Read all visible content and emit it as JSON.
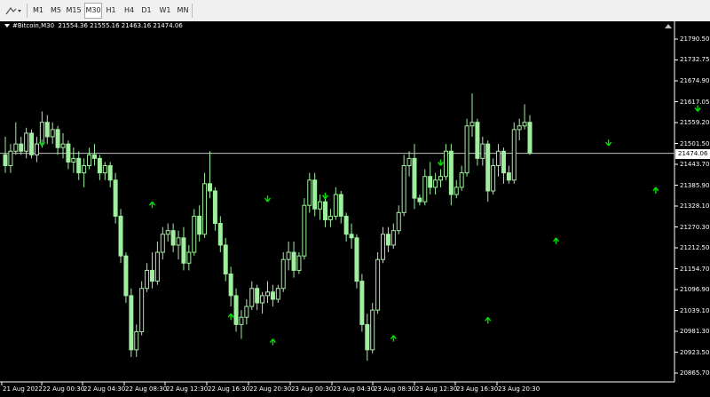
{
  "toolbar": {
    "timeframes": [
      "M1",
      "M5",
      "M15",
      "M30",
      "H1",
      "H4",
      "D1",
      "W1",
      "MN"
    ],
    "active": "M30"
  },
  "chart": {
    "symbol": "#Bitcoin,M30",
    "ohlc": "21554.36 21555.16 21463.16 21474.06",
    "current_price": "21474.06",
    "price_labels": [
      "21790.50",
      "21732.75",
      "21674.90",
      "21617.05",
      "21559.20",
      "21501.50",
      "21443.70",
      "21385.90",
      "21328.10",
      "21270.30",
      "21212.50",
      "21154.70",
      "21096.90",
      "21039.10",
      "20981.30",
      "20923.50",
      "20865.70"
    ],
    "time_labels": [
      "21 Aug 2022",
      "22 Aug 00:30",
      "22 Aug 04:30",
      "22 Aug 08:30",
      "22 Aug 12:30",
      "22 Aug 16:30",
      "22 Aug 20:30",
      "23 Aug 00:30",
      "23 Aug 04:30",
      "23 Aug 08:30",
      "23 Aug 12:30",
      "23 Aug 16:30",
      "23 Aug 20:30"
    ],
    "colors": {
      "background": "#000000",
      "candle": "#9fef9f",
      "arrow": "#00e000",
      "axis": "#ffffff",
      "price_line": "#c0c0c0"
    }
  },
  "chart_data": {
    "type": "candlestick",
    "ylim": [
      20865.7,
      21790.5
    ],
    "candles": [
      [
        21470,
        21520,
        21420,
        21440
      ],
      [
        21440,
        21500,
        21420,
        21480
      ],
      [
        21480,
        21560,
        21470,
        21500
      ],
      [
        21500,
        21520,
        21470,
        21480
      ],
      [
        21480,
        21545,
        21460,
        21530
      ],
      [
        21530,
        21540,
        21460,
        21470
      ],
      [
        21470,
        21520,
        21450,
        21500
      ],
      [
        21500,
        21590,
        21490,
        21560
      ],
      [
        21560,
        21580,
        21500,
        21520
      ],
      [
        21520,
        21560,
        21500,
        21540
      ],
      [
        21540,
        21550,
        21470,
        21490
      ],
      [
        21490,
        21530,
        21460,
        21500
      ],
      [
        21500,
        21510,
        21430,
        21450
      ],
      [
        21450,
        21490,
        21420,
        21460
      ],
      [
        21460,
        21480,
        21400,
        21420
      ],
      [
        21420,
        21460,
        21380,
        21440
      ],
      [
        21440,
        21490,
        21430,
        21470
      ],
      [
        21470,
        21500,
        21440,
        21460
      ],
      [
        21460,
        21470,
        21400,
        21420
      ],
      [
        21420,
        21450,
        21400,
        21440
      ],
      [
        21440,
        21450,
        21380,
        21400
      ],
      [
        21400,
        21420,
        21280,
        21300
      ],
      [
        21300,
        21320,
        21170,
        21190
      ],
      [
        21190,
        21200,
        21060,
        21080
      ],
      [
        21080,
        21100,
        20910,
        20930
      ],
      [
        20930,
        21000,
        20910,
        20980
      ],
      [
        20980,
        21120,
        20970,
        21100
      ],
      [
        21100,
        21170,
        21090,
        21150
      ],
      [
        21150,
        21200,
        21100,
        21120
      ],
      [
        21120,
        21230,
        21110,
        21200
      ],
      [
        21200,
        21270,
        21180,
        21250
      ],
      [
        21250,
        21280,
        21230,
        21260
      ],
      [
        21260,
        21280,
        21200,
        21220
      ],
      [
        21220,
        21260,
        21180,
        21240
      ],
      [
        21240,
        21270,
        21150,
        21170
      ],
      [
        21170,
        21220,
        21150,
        21200
      ],
      [
        21200,
        21320,
        21190,
        21300
      ],
      [
        21300,
        21330,
        21230,
        21250
      ],
      [
        21250,
        21420,
        21240,
        21390
      ],
      [
        21390,
        21480,
        21350,
        21370
      ],
      [
        21370,
        21380,
        21260,
        21280
      ],
      [
        21280,
        21300,
        21200,
        21220
      ],
      [
        21220,
        21240,
        21120,
        21140
      ],
      [
        21140,
        21160,
        21050,
        21080
      ],
      [
        21080,
        21100,
        20980,
        21000
      ],
      [
        21000,
        21040,
        20960,
        21020
      ],
      [
        21020,
        21070,
        21000,
        21050
      ],
      [
        21050,
        21120,
        21040,
        21100
      ],
      [
        21100,
        21110,
        21040,
        21060
      ],
      [
        21060,
        21090,
        21030,
        21080
      ],
      [
        21080,
        21120,
        21060,
        21090
      ],
      [
        21090,
        21110,
        21050,
        21070
      ],
      [
        21070,
        21110,
        21060,
        21100
      ],
      [
        21100,
        21200,
        21090,
        21180
      ],
      [
        21180,
        21230,
        21150,
        21200
      ],
      [
        21200,
        21230,
        21130,
        21150
      ],
      [
        21150,
        21200,
        21140,
        21190
      ],
      [
        21190,
        21350,
        21180,
        21330
      ],
      [
        21330,
        21420,
        21310,
        21400
      ],
      [
        21400,
        21420,
        21300,
        21320
      ],
      [
        21320,
        21360,
        21290,
        21340
      ],
      [
        21340,
        21350,
        21270,
        21290
      ],
      [
        21290,
        21320,
        21270,
        21300
      ],
      [
        21300,
        21380,
        21290,
        21360
      ],
      [
        21360,
        21370,
        21280,
        21300
      ],
      [
        21300,
        21310,
        21230,
        21250
      ],
      [
        21250,
        21280,
        21210,
        21240
      ],
      [
        21240,
        21250,
        21100,
        21120
      ],
      [
        21120,
        21140,
        20980,
        21000
      ],
      [
        21000,
        21030,
        20900,
        20930
      ],
      [
        20930,
        21060,
        20920,
        21040
      ],
      [
        21040,
        21200,
        21030,
        21180
      ],
      [
        21180,
        21270,
        21170,
        21250
      ],
      [
        21250,
        21270,
        21200,
        21220
      ],
      [
        21220,
        21280,
        21210,
        21260
      ],
      [
        21260,
        21330,
        21250,
        21310
      ],
      [
        21310,
        21470,
        21300,
        21440
      ],
      [
        21440,
        21480,
        21410,
        21460
      ],
      [
        21460,
        21500,
        21320,
        21350
      ],
      [
        21350,
        21360,
        21330,
        21340
      ],
      [
        21340,
        21430,
        21330,
        21410
      ],
      [
        21410,
        21450,
        21360,
        21380
      ],
      [
        21380,
        21420,
        21360,
        21400
      ],
      [
        21400,
        21430,
        21380,
        21410
      ],
      [
        21410,
        21500,
        21400,
        21480
      ],
      [
        21480,
        21500,
        21330,
        21360
      ],
      [
        21360,
        21400,
        21350,
        21380
      ],
      [
        21380,
        21440,
        21370,
        21420
      ],
      [
        21420,
        21570,
        21410,
        21550
      ],
      [
        21550,
        21640,
        21520,
        21560
      ],
      [
        21560,
        21570,
        21440,
        21460
      ],
      [
        21460,
        21520,
        21440,
        21500
      ],
      [
        21500,
        21510,
        21340,
        21370
      ],
      [
        21370,
        21460,
        21360,
        21440
      ],
      [
        21440,
        21500,
        21410,
        21480
      ],
      [
        21480,
        21490,
        21390,
        21420
      ],
      [
        21420,
        21440,
        21390,
        21400
      ],
      [
        21400,
        21560,
        21390,
        21540
      ],
      [
        21540,
        21570,
        21510,
        21550
      ],
      [
        21550,
        21610,
        21540,
        21560
      ],
      [
        21560,
        21580,
        21470,
        21474
      ]
    ],
    "arrows_down": [
      [
        7,
        21505
      ],
      [
        50,
        21350
      ],
      [
        61,
        21358
      ],
      [
        83,
        21450
      ],
      [
        115,
        21505
      ],
      [
        132,
        21600
      ]
    ],
    "arrows_up": [
      [
        28,
        21330
      ],
      [
        43,
        21020
      ],
      [
        51,
        20950
      ],
      [
        74,
        20960
      ],
      [
        92,
        21010
      ],
      [
        105,
        21230
      ],
      [
        124,
        21370
      ]
    ]
  }
}
